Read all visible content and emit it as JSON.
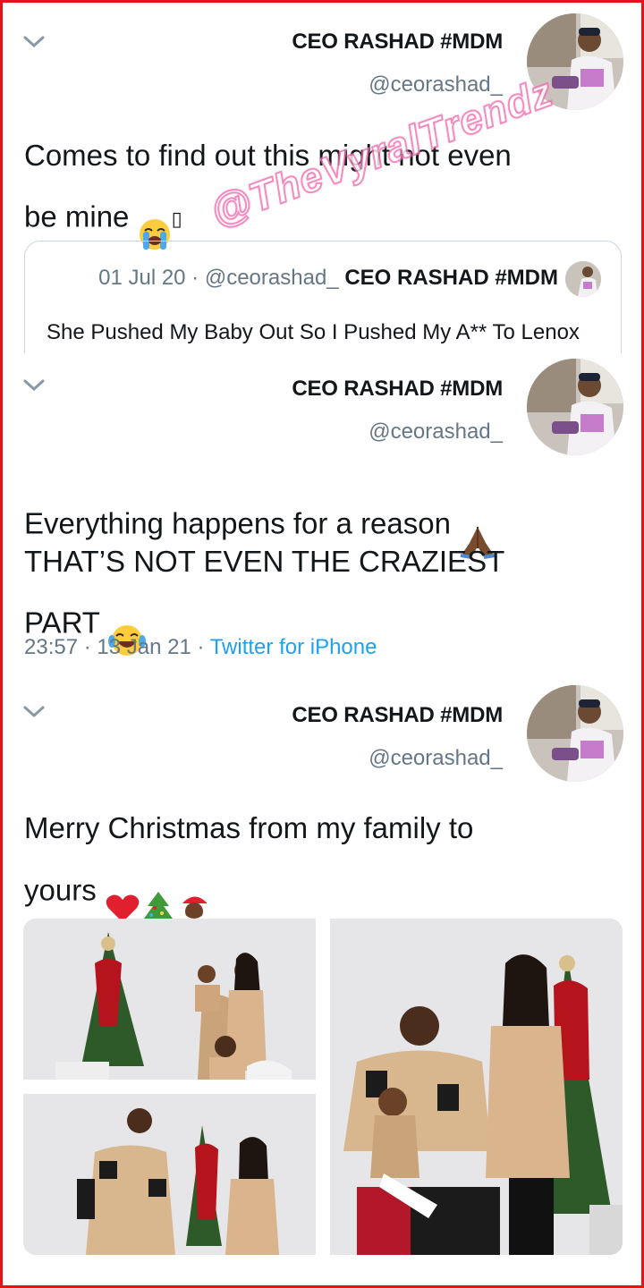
{
  "watermark": "@TheVyralTrendz",
  "tweets": [
    {
      "name": "CEO RASHAD #MDM",
      "handle": "@ceorashad_",
      "text": "Comes to find out this might not even\nbe mine",
      "emoji": [
        "loudly-crying-face"
      ],
      "quoted": {
        "date": "01 Jul 20",
        "handle": "@ceorashad_",
        "name": "CEO RASHAD #MDM",
        "text": "She Pushed My Baby Out So I Pushed My A** To Lenox"
      }
    },
    {
      "name": "CEO RASHAD #MDM",
      "handle": "@ceorashad_",
      "text_line1": "Everything happens for a reason",
      "text_line2": "THAT’S NOT EVEN THE CRAZIEST\nPART",
      "emoji": [
        "folded-hands",
        "tears-of-joy"
      ],
      "time": "23:57",
      "date": "13 Jan 21",
      "source": "Twitter for iPhone"
    },
    {
      "name": "CEO RASHAD #MDM",
      "handle": "@ceorashad_",
      "text": "Merry Christmas from my family to\nyours",
      "emoji": [
        "red-heart",
        "christmas-tree",
        "santa"
      ],
      "photos": [
        "family-photo-1",
        "family-photo-2",
        "family-photo-3"
      ]
    }
  ],
  "colors": {
    "frame": "#e5121a",
    "link": "#1da1f2",
    "secondary": "#657786"
  }
}
